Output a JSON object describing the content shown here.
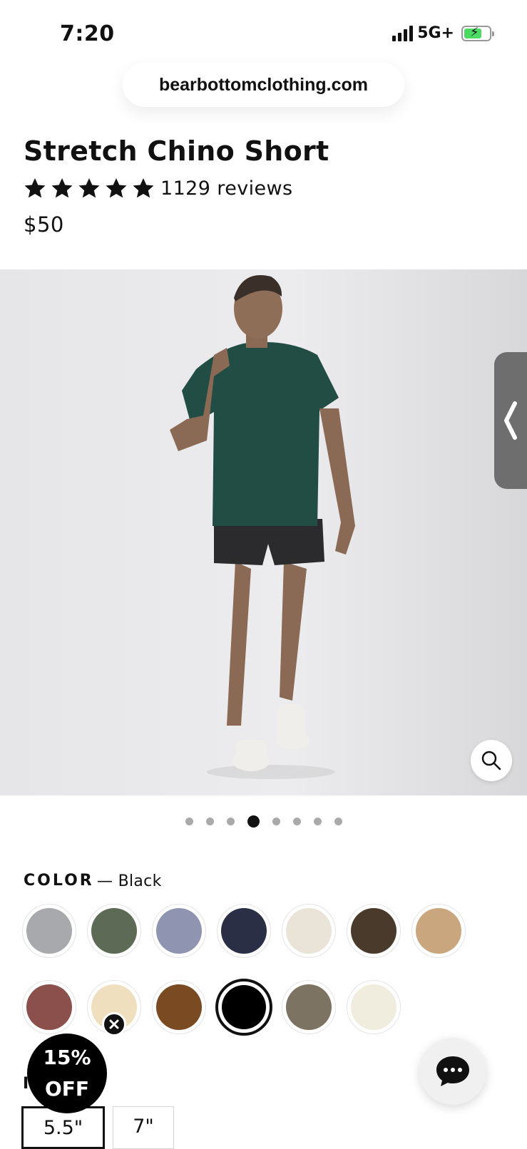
{
  "status_bar": {
    "time": "7:20",
    "network": "5G+"
  },
  "browser": {
    "url": "bearbottomclothing.com"
  },
  "product": {
    "title": "Stretch Chino Short",
    "rating": 5,
    "reviews": "1129 reviews",
    "price": "$50"
  },
  "gallery": {
    "image_count": 8,
    "active_index": 3
  },
  "color": {
    "label": "COLOR",
    "selected": "— Black",
    "swatches": [
      "#a8a9ad",
      "#5d6a55",
      "#8f95b0",
      "#2a2f45",
      "#e9e3d8",
      "#4a3a2c",
      "#c9a67d",
      "#8b4f4c",
      "#efdfbe",
      "#7a4a23",
      "#000000",
      "#7d7362",
      "#f0ecde"
    ],
    "selected_index": 10
  },
  "promo": {
    "line1": "15%",
    "line2": "OFF"
  },
  "length": {
    "label_partial": "I",
    "options": [
      "5.5\"",
      "7\""
    ],
    "selected_index": 0
  }
}
